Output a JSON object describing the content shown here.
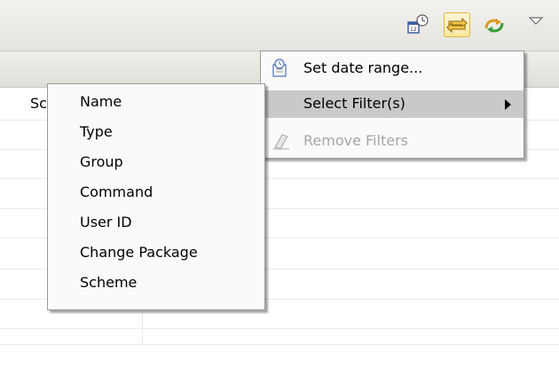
{
  "toolbar": {
    "icons": [
      "history-calendar-icon",
      "compare-arrows-icon",
      "refresh-sync-icon",
      "view-menu-chevron-icon"
    ]
  },
  "table": {
    "first_column_header": "Sc"
  },
  "menu": {
    "items": [
      {
        "label": "Set date range...",
        "icon": "calendar-clock-icon"
      },
      {
        "label": "Select Filter(s)",
        "has_submenu": true,
        "highlighted": true
      },
      {
        "label": "Remove Filters",
        "icon": "eraser-icon",
        "disabled": true
      }
    ]
  },
  "submenu": {
    "items": [
      {
        "label": "Name"
      },
      {
        "label": "Type"
      },
      {
        "label": "Group"
      },
      {
        "label": "Command"
      },
      {
        "label": "User ID"
      },
      {
        "label": "Change Package"
      },
      {
        "label": "Scheme"
      }
    ]
  },
  "colors": {
    "toolbar_bg": "#e9e7e2",
    "menu_bg": "#fafafa",
    "highlight": "#c9c9c9",
    "disabled_text": "#a6a6a6",
    "active_button_border": "#e8b53d"
  }
}
